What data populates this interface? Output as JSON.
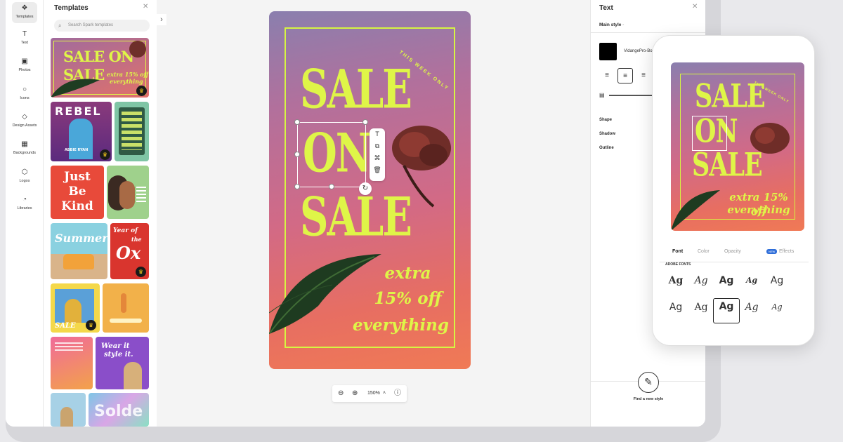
{
  "rail": {
    "items": [
      {
        "label": "Templates",
        "icon": "templates-icon"
      },
      {
        "label": "Text",
        "icon": "text-icon"
      },
      {
        "label": "Photos",
        "icon": "photos-icon"
      },
      {
        "label": "Icons",
        "icon": "icons-icon"
      },
      {
        "label": "Design Assets",
        "icon": "design-assets-icon"
      },
      {
        "label": "Backgrounds",
        "icon": "backgrounds-icon"
      },
      {
        "label": "Logos",
        "icon": "logos-icon"
      },
      {
        "label": "Libraries",
        "icon": "libraries-icon"
      }
    ]
  },
  "templates": {
    "title": "Templates",
    "search_placeholder": "Search Spark templates",
    "t1": {
      "line1": "SALE ON",
      "line2": "SALE",
      "sub1": "extra 15% off",
      "sub2": "everything"
    },
    "t2": {
      "title": "REBEL",
      "name": "ABBIE RYAN"
    },
    "t3": {
      "line1": "Just",
      "line2": "Be",
      "line3": "Kind"
    },
    "t4": {
      "title": "Summer"
    },
    "t5": {
      "line1": "Year of",
      "line2": "the",
      "line3": "Ox"
    },
    "t6": {
      "label": "SALE"
    },
    "t7": {
      "line1": "Wear it",
      "line2": "style it."
    },
    "t8": {
      "label": "Solde"
    }
  },
  "poster": {
    "badge": "THIS WEEK ONLY",
    "line1": "SALE",
    "line2": "ON",
    "line3": "SALE",
    "extra1": "extra",
    "extra2": "15% off",
    "extra3": "everything"
  },
  "zoom": {
    "value": "150%"
  },
  "text_panel": {
    "title": "Text",
    "style_label": "Main style",
    "font_name": "VidangePro-Bold",
    "color": "#000000",
    "shape": "Shape",
    "shadow": "Shadow",
    "outline": "Outline",
    "find_style": "Find a new style"
  },
  "phone": {
    "tabs": {
      "font": "Font",
      "color": "Color",
      "opacity": "Opacity",
      "new": "NEW",
      "effects": "Effects"
    },
    "adobe_fonts": "ADOBE FONTS",
    "font_sample": "Ag"
  },
  "colors": {
    "accent": "#dff548",
    "crown": "#ffd21e",
    "new_badge": "#2f6ed9"
  }
}
